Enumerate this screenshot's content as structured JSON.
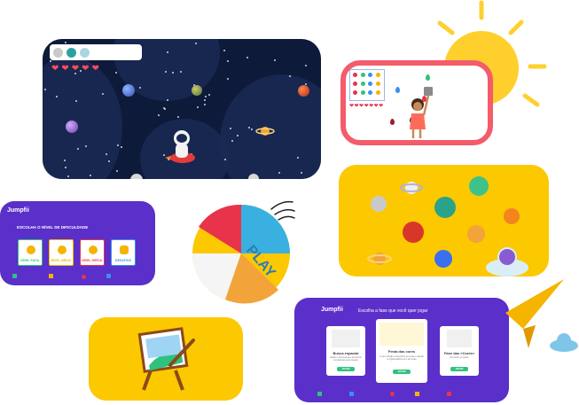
{
  "colors": {
    "purple": "#5b2fc9",
    "yellow": "#fcc800",
    "space": "#0e1a3a",
    "coral": "#f45b6b",
    "sun": "#ffcf2e"
  },
  "difficulty": {
    "brand": "Jumpfii",
    "heading": "ESCOLHA O NÍVEL DE DIFICULDADE",
    "levels": [
      {
        "label": "NÍVEL FÁCIL",
        "color": "#2ec27e"
      },
      {
        "label": "NÍVEL MÉDIO",
        "color": "#f5b400"
      },
      {
        "label": "NÍVEL DIFÍCIL",
        "color": "#e8334a"
      },
      {
        "label": "DESAFIOS",
        "color": "#3a8ff0"
      }
    ]
  },
  "phase": {
    "brand": "Jumpfii",
    "heading": "Escolha a fase que você quer jogar",
    "cards": [
      {
        "title": "Busca espacial",
        "desc": "Ajude o astronauta a encontrar os planetas pelo espaço",
        "button": "JOGAR"
      },
      {
        "title": "Festa das cores",
        "desc": "A sua missão é descobrir as cores e ajudar a organizadora com as tintas",
        "button": "JOGAR"
      },
      {
        "title": "Fase das «Cores»",
        "desc": "Encontre os pares",
        "button": "JOGAR"
      }
    ]
  },
  "space_game": {
    "hearts": 5,
    "hud_icons": [
      "planet-icon",
      "planet-icon",
      "planet-icon"
    ]
  },
  "color_game": {
    "hearts": 7
  },
  "beach_ball": {
    "text": "PLAY"
  }
}
